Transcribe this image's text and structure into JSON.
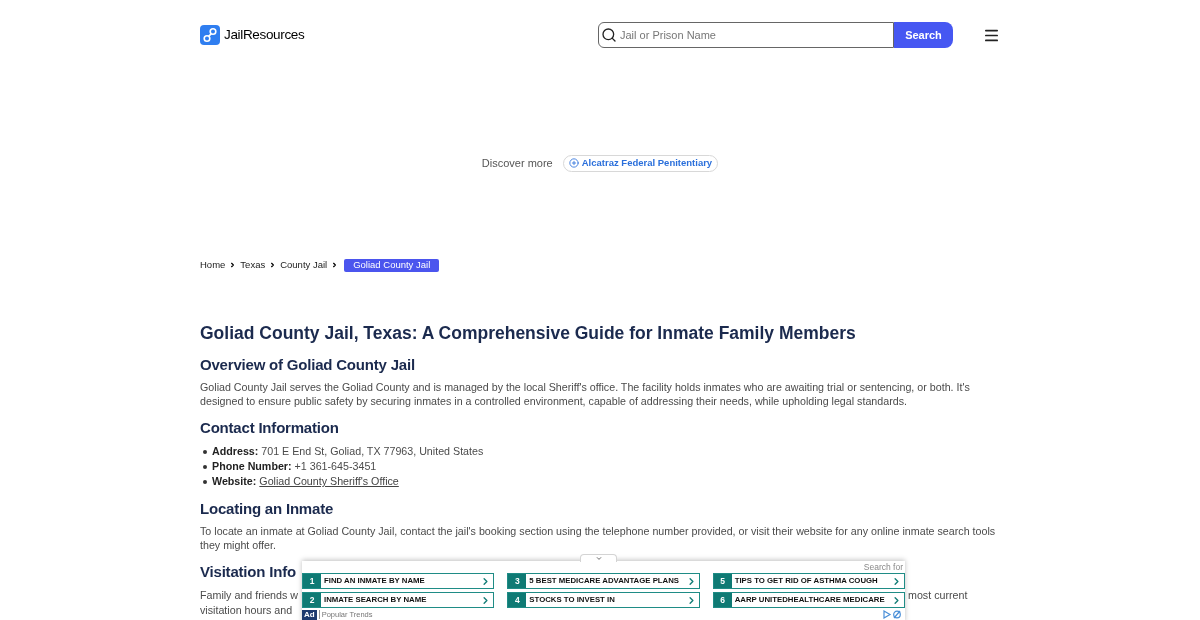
{
  "header": {
    "logo_text": "JailResources",
    "search": {
      "placeholder": "Jail or Prison Name",
      "button": "Search"
    }
  },
  "discover": {
    "label": "Discover more",
    "links": [
      {
        "text": "Alcatraz Federal Penitentiary"
      }
    ]
  },
  "breadcrumb": [
    {
      "label": "Home",
      "current": false
    },
    {
      "label": "Texas",
      "current": false
    },
    {
      "label": "County Jail",
      "current": false
    },
    {
      "label": "Goliad County Jail",
      "current": true
    }
  ],
  "article": {
    "title": "Goliad County Jail, Texas: A Comprehensive Guide for Inmate Family Members",
    "sections": [
      {
        "heading": "Overview of Goliad County Jail",
        "blocks": [
          {
            "kind": "paragraph",
            "text": "Goliad County Jail serves the Goliad County and is managed by the local Sheriff's office. The facility holds inmates who are awaiting trial or sentencing, or both. It's designed to ensure public safety by securing inmates in a controlled environment, capable of addressing their needs, while upholding legal standards."
          }
        ]
      },
      {
        "heading": "Contact Information",
        "blocks": [
          {
            "kind": "list",
            "items": [
              {
                "kind": "text",
                "label": "Address:",
                "value": "701 E End St, Goliad, TX 77963, United States"
              },
              {
                "kind": "text",
                "label": "Phone Number:",
                "value": "+1 361-645-3451"
              },
              {
                "kind": "link",
                "label": "Website:",
                "value": "Goliad County Sheriff's Office"
              }
            ]
          }
        ]
      },
      {
        "heading": "Locating an Inmate",
        "blocks": [
          {
            "kind": "paragraph",
            "text": "To locate an inmate at Goliad County Jail, contact the jail's booking section using the telephone number provided, or visit their website for any online inmate search tools they might offer."
          }
        ]
      },
      {
        "heading": "Visitation Info",
        "blocks": [
          {
            "kind": "covered",
            "lines": [
              {
                "left": "Family and friends w",
                "right": "most current"
              },
              {
                "left": "visitation hours and"
              }
            ]
          }
        ]
      }
    ]
  },
  "ad_bar": {
    "search_label": "Search for",
    "links": [
      {
        "number": "1",
        "text": "FIND AN INMATE BY NAME"
      },
      {
        "number": "2",
        "text": "INMATE SEARCH BY NAME"
      },
      {
        "number": "3",
        "text": "5 BEST MEDICARE ADVANTAGE PLANS"
      },
      {
        "number": "4",
        "text": "STOCKS TO INVEST IN"
      },
      {
        "number": "5",
        "text": "TIPS TO GET RID OF ASTHMA COUGH"
      },
      {
        "number": "6",
        "text": "AARP UNITEDHEALTHCARE MEDICARE"
      }
    ],
    "badge": "Ad",
    "source": "Popular Trends"
  }
}
